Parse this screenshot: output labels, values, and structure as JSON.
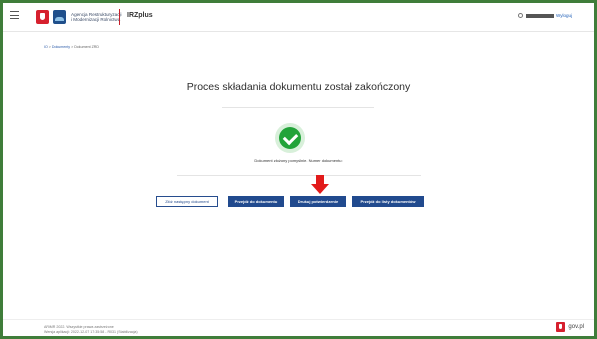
{
  "header": {
    "org_name_line1": "Agencja Restrukturyzacji",
    "org_name_line2": "i Modernizacji Rolnictwa",
    "app_name": "IRZplus",
    "logout_label": "Wyloguj"
  },
  "breadcrumb": {
    "home": "IO",
    "sep": ">",
    "documents": "Dokumenty",
    "current": "Dokument ZRD"
  },
  "main": {
    "title": "Proces składania dokumentu został zakończony",
    "message": "Dokument złożony pomyślnie. Numer dokumentu:"
  },
  "buttons": {
    "next_document": "Złóż następny dokument",
    "go_to_document": "Przejdź do dokumentu",
    "print_confirmation": "Drukuj potwierdzenie",
    "go_to_list": "Przejdź do listy dokumentów"
  },
  "footer": {
    "copyright": "ARiMR 2022. Wszystkie prawa zastrzeżone",
    "version": "Wersja aplikacji: 2022-12-07 17:35:58 - R031 (Stabilizacja)",
    "gov_label": "gov.pl"
  },
  "colors": {
    "primary": "#214a8e",
    "success": "#22a339",
    "arrow": "#e21b1b",
    "frame_border": "#3f7d3a"
  }
}
